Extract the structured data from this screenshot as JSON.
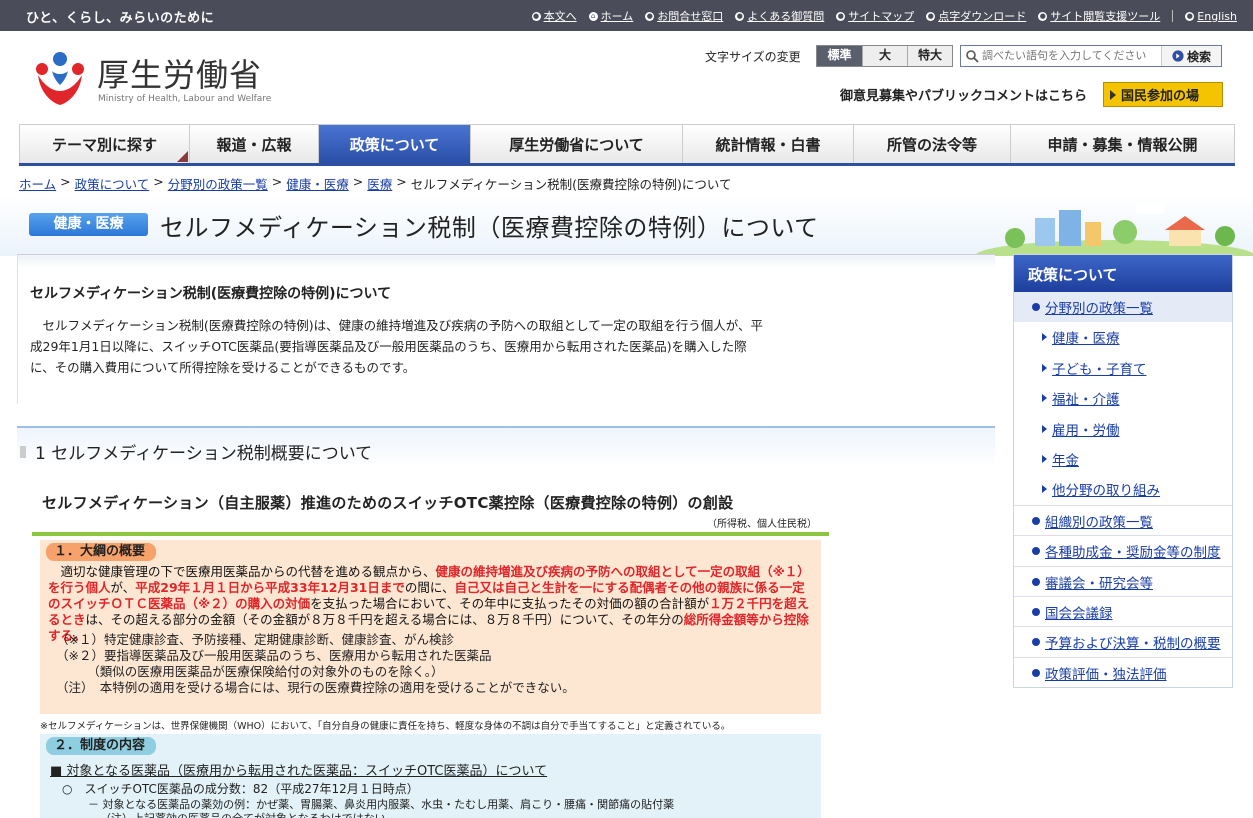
{
  "topbar": {
    "tagline": "ひと、くらし、みらいのために",
    "links": [
      "本文へ",
      "ホーム",
      "お問合せ窓口",
      "よくある御質問",
      "サイトマップ",
      "点字ダウンロード",
      "サイト閲覧支援ツール"
    ],
    "lang": "English"
  },
  "logo": {
    "name": "厚生労働省",
    "en": "Ministry of Health, Labour and Welfare"
  },
  "fontsize": {
    "label": "文字サイズの変更",
    "options": [
      "標準",
      "大",
      "特大"
    ],
    "selected": "標準"
  },
  "search": {
    "placeholder": "調べたい語句を入力してください",
    "button": "検索"
  },
  "comment": {
    "text": "御意見募集やパブリックコメントはこちら",
    "button": "国民参加の場"
  },
  "gnav": [
    "テーマ別に探す",
    "報道・広報",
    "政策について",
    "厚生労働省について",
    "統計情報・白書",
    "所管の法令等",
    "申請・募集・情報公開"
  ],
  "gnav_active": "政策について",
  "breadcrumb": {
    "links": [
      "ホーム",
      "政策について",
      "分野別の政策一覧",
      "健康・医療",
      "医療"
    ],
    "current": "セルフメディケーション税制(医療費控除の特例)について"
  },
  "title": {
    "category": "健康・医療",
    "text": "セルフメディケーション税制（医療費控除の特例）について"
  },
  "main": {
    "section_title": "セルフメディケーション税制(医療費控除の特例)について",
    "intro": "セルフメディケーション税制(医療費控除の特例)は、健康の維持増進及び疾病の予防への取組として一定の取組を行う個人が、平成29年1月1日以降に、スイッチOTC医薬品(要指導医薬品及び一般用医薬品のうち、医療用から転用された医薬品)を購入した際に、その購入費用について所得控除を受けることができるものです。",
    "h2": "1  セルフメディケーション税制概要について"
  },
  "figure": {
    "title": "セルフメディケーション（自主服薬）推進のためのスイッチOTC薬控除（医療費控除の特例）の創設",
    "subtitle": "（所得税、個人住民税）",
    "section1_label": "１．大綱の概要",
    "s1_p1": "適切な健康管理の下で医療用医薬品からの代替を進める観点から、",
    "s1_r1": "健康の維持増進及び疾病の予防への取組として一定の取組（※１）を行う個人",
    "s1_p2": "が、",
    "s1_r2": "平成29年１月１日から平成33年12月31日まで",
    "s1_p3": "の間に、",
    "s1_r3": "自己又は自己と生計を一にする配偶者その他の親族に係る一定のスイッチＯＴＣ医薬品（※２）の購入の対価",
    "s1_p4": "を支払った場合において、その年中に支払ったその対価の額の合計額が",
    "s1_r4": "１万２千円を超えるとき",
    "s1_p5": "は、その超える部分の金額（その金額が８万８千円を超える場合には、８万８千円）について、その年分の",
    "s1_r5": "総所得金額等から控除する。",
    "notes": "（※１）特定健康診査、予防接種、定期健康診断、健康診査、がん検診\n（※２）要指導医薬品及び一般用医薬品のうち、医療用から転用された医薬品\n　　　（類似の医療用医薬品が医療保険給付の対象外のものを除く。）\n（注）　本特例の適用を受ける場合には、現行の医療費控除の適用を受けることができない。",
    "who_note": "※セルフメディケーションは、世界保健機関（WHO）において、「自分自身の健康に責任を持ち、軽度な身体の不調は自分で手当てすること」と定義されている。",
    "section2_label": "２．制度の内容",
    "s2_heading": "■ 対象となる医薬品（医療用から転用された医薬品：スイッチOTC医薬品）について",
    "s2_l1": "○　スイッチOTC医薬品の成分数：82（平成27年12月１日時点）",
    "s2_l2": "－ 対象となる医薬品の薬効の例：かぜ薬、胃腸薬、鼻炎用内服薬、水虫・たむし用薬、肩こり・腰痛・関節痛の貼付薬",
    "s2_l3": "（注）上記薬効の医薬品の全てが対象となるわけではない"
  },
  "sidebar": {
    "head": "政策について",
    "current": "分野別の政策一覧",
    "sub": [
      "健康・医療",
      "子ども・子育て",
      "福祉・介護",
      "雇用・労働",
      "年金",
      "他分野の取り組み"
    ],
    "links": [
      "組織別の政策一覧",
      "各種助成金・奨励金等の制度",
      "審議会・研究会等",
      "国会会議録",
      "予算および決算・税制の概要",
      "政策評価・独法評価"
    ]
  },
  "colors": {
    "accent": "#2f4fa0",
    "brand_red": "#e0262b",
    "topbar": "#4a4c59",
    "highlight_red": "#e0262b",
    "badge_yellow": "#f5c400"
  }
}
